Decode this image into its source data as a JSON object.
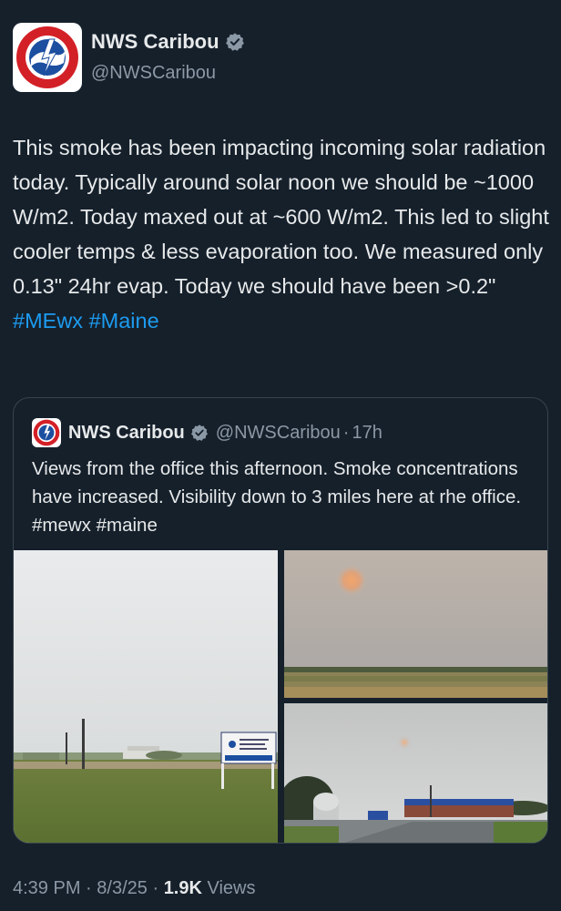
{
  "author": {
    "name": "NWS Caribou",
    "handle": "@NWSCaribou",
    "verified_icon": "verified-badge-icon",
    "avatar_text": "NATIONAL WEATHER SERVICE"
  },
  "tweet": {
    "text_before_tags": "This smoke has been impacting incoming solar radiation today. Typically around solar noon we should be ~1000 W/m2. Today maxed out at ~600 W/m2. This led to slight cooler temps & less evaporation too. We measured only 0.13\" 24hr evap. Today we should have been >0.2\"",
    "hashtag1": "#MEwx",
    "hashtag2": "#Maine"
  },
  "quoted_tweet": {
    "name": "NWS Caribou",
    "handle": "@NWSCaribou",
    "separator": "·",
    "time": "17h",
    "text": "Views from the office this afternoon. Smoke concentrations have increased. Visibility down to 3 miles here at rhe office. #mewx #maine",
    "sign_text": "National Oceanic and Atmospheric Administration"
  },
  "footer": {
    "time": "4:39 PM",
    "dot": "·",
    "date": "8/3/25",
    "views_count": "1.9K",
    "views_label": "Views"
  },
  "colors": {
    "background": "#15202b",
    "link": "#1d9bf0",
    "secondary_text": "#8b98a5",
    "verified": "#8b98a5"
  }
}
